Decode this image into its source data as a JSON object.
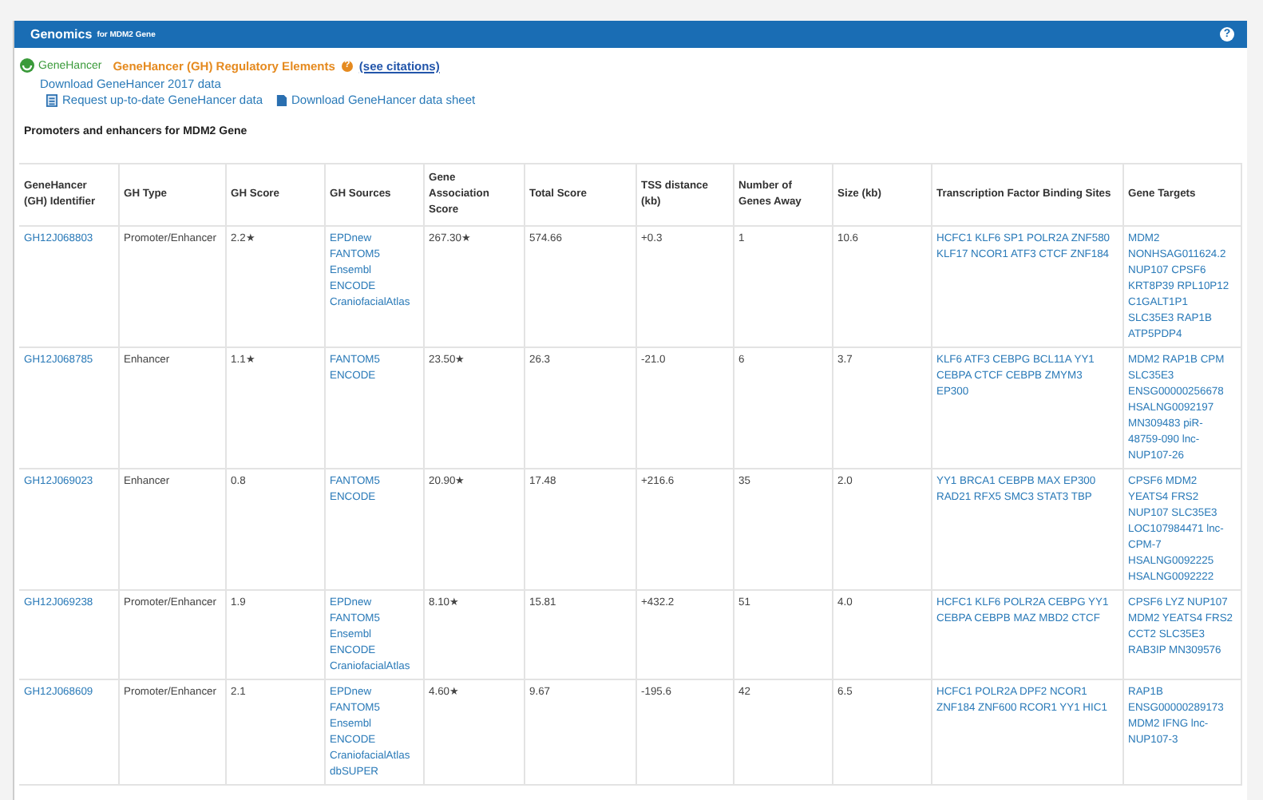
{
  "panel": {
    "title": "Genomics",
    "subtitle": "for MDM2 Gene",
    "help": "?"
  },
  "genehancer": {
    "logo": "GeneHancer",
    "title": "GeneHancer (GH) Regulatory Elements",
    "help": "?",
    "citations": "(see citations)",
    "links": [
      {
        "kind": "plain",
        "text": "Download GeneHancer 2017 data"
      },
      {
        "kind": "request",
        "text": "Request up-to-date GeneHancer data"
      },
      {
        "kind": "document",
        "text": "Download GeneHancer data sheet"
      }
    ]
  },
  "section_title": "Promoters and enhancers for MDM2 Gene",
  "table": {
    "columns": [
      "GeneHancer (GH) Identifier",
      "GH Type",
      "GH Score",
      "GH Sources",
      "Gene Association Score",
      "Total Score",
      "TSS distance (kb)",
      "Number of Genes Away",
      "Size (kb)",
      "Transcription Factor Binding Sites",
      "Gene Targets"
    ],
    "rows": [
      {
        "id": "GH12J068803",
        "type": "Promoter/Enhancer",
        "gh_score": "2.2★",
        "sources": [
          "EPDnew",
          "FANTOM5",
          "Ensembl ENCODE",
          "CraniofacialAtlas"
        ],
        "association": "267.30★",
        "total": "574.66",
        "tss": "+0.3",
        "genes_away": "1",
        "size": "10.6",
        "tfbs": "HCFC1 KLF6 SP1 POLR2A ZNF580 KLF17 NCOR1 ATF3 CTCF ZNF184",
        "targets": "MDM2 NONHSAG011624.2 NUP107 CPSF6 KRT8P39 RPL10P12 C1GALT1P1 SLC35E3 RAP1B ATP5PDP4"
      },
      {
        "id": "GH12J068785",
        "type": "Enhancer",
        "gh_score": "1.1★",
        "sources": [
          "FANTOM5",
          "ENCODE"
        ],
        "association": "23.50★",
        "total": "26.3",
        "tss": "-21.0",
        "genes_away": "6",
        "size": "3.7",
        "tfbs": "KLF6 ATF3 CEBPG BCL11A YY1 CEBPA CTCF CEBPB ZMYM3 EP300",
        "targets": "MDM2 RAP1B CPM SLC35E3 ENSG00000256678 HSALNG0092197 MN309483 piR-48759-090 lnc-NUP107-26"
      },
      {
        "id": "GH12J069023",
        "type": "Enhancer",
        "gh_score": "0.8",
        "sources": [
          "FANTOM5",
          "ENCODE"
        ],
        "association": "20.90★",
        "total": "17.48",
        "tss": "+216.6",
        "genes_away": "35",
        "size": "2.0",
        "tfbs": "YY1 BRCA1 CEBPB MAX EP300 RAD21 RFX5 SMC3 STAT3 TBP",
        "targets": "CPSF6 MDM2 YEATS4 FRS2 NUP107 SLC35E3 LOC107984471 lnc-CPM-7 HSALNG0092225 HSALNG0092222"
      },
      {
        "id": "GH12J069238",
        "type": "Promoter/Enhancer",
        "gh_score": "1.9",
        "sources": [
          "EPDnew",
          "FANTOM5",
          "Ensembl ENCODE",
          "CraniofacialAtlas"
        ],
        "association": "8.10★",
        "total": "15.81",
        "tss": "+432.2",
        "genes_away": "51",
        "size": "4.0",
        "tfbs": "HCFC1 KLF6 POLR2A CEBPG YY1 CEBPA CEBPB MAZ MBD2 CTCF",
        "targets": "CPSF6 LYZ NUP107 MDM2 YEATS4 FRS2 CCT2 SLC35E3 RAB3IP MN309576"
      },
      {
        "id": "GH12J068609",
        "type": "Promoter/Enhancer",
        "gh_score": "2.1",
        "sources": [
          "EPDnew",
          "FANTOM5",
          "Ensembl ENCODE",
          "CraniofacialAtlas",
          "dbSUPER"
        ],
        "association": "4.60★",
        "total": "9.67",
        "tss": "-195.6",
        "genes_away": "42",
        "size": "6.5",
        "tfbs": "HCFC1 POLR2A DPF2 NCOR1 ZNF184 ZNF600 RCOR1 YY1 HIC1",
        "targets": "RAP1B ENSG00000289173 MDM2 IFNG lnc-NUP107-3"
      }
    ]
  }
}
